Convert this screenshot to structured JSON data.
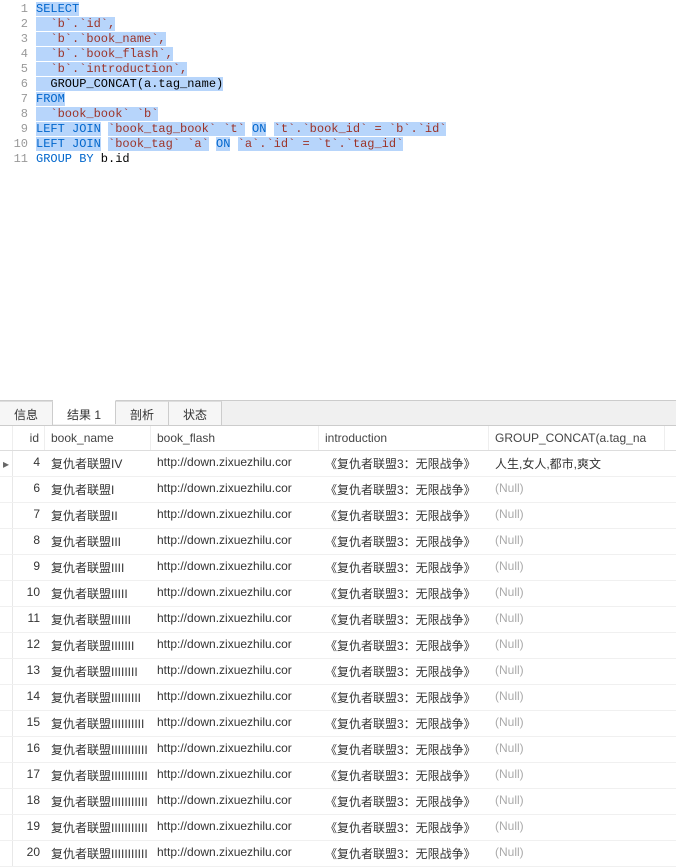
{
  "editor": {
    "lines": [
      {
        "n": 1,
        "tokens": [
          {
            "t": "SELECT",
            "c": "kw",
            "s": true
          }
        ]
      },
      {
        "n": 2,
        "tokens": [
          {
            "t": "  `b`.`id`,",
            "c": "str",
            "s": true
          }
        ]
      },
      {
        "n": 3,
        "tokens": [
          {
            "t": "  `b`.`book_name`,",
            "c": "str",
            "s": true
          }
        ]
      },
      {
        "n": 4,
        "tokens": [
          {
            "t": "  `b`.`book_flash`,",
            "c": "str",
            "s": true
          }
        ]
      },
      {
        "n": 5,
        "tokens": [
          {
            "t": "  `b`.`introduction`,",
            "c": "str",
            "s": true
          }
        ]
      },
      {
        "n": 6,
        "tokens": [
          {
            "t": "  GROUP_CONCAT(a.tag_name)",
            "c": "",
            "s": true
          }
        ]
      },
      {
        "n": 7,
        "tokens": [
          {
            "t": "FROM",
            "c": "kw",
            "s": true
          }
        ]
      },
      {
        "n": 8,
        "tokens": [
          {
            "t": "  `book_book` `b`",
            "c": "str",
            "s": true
          }
        ]
      },
      {
        "n": 9,
        "tokens": [
          {
            "t": "LEFT JOIN",
            "c": "kw",
            "s": true
          },
          {
            "t": " "
          },
          {
            "t": "`book_tag_book` `t`",
            "c": "str",
            "s": true
          },
          {
            "t": " "
          },
          {
            "t": "ON",
            "c": "kw",
            "s": true
          },
          {
            "t": " "
          },
          {
            "t": "`t`.`book_id` = `b`.`id`",
            "c": "str",
            "s": true
          }
        ]
      },
      {
        "n": 10,
        "tokens": [
          {
            "t": "LEFT JOIN",
            "c": "kw",
            "s": true
          },
          {
            "t": " "
          },
          {
            "t": "`book_tag` `a`",
            "c": "str",
            "s": true
          },
          {
            "t": " "
          },
          {
            "t": "ON",
            "c": "kw",
            "s": true
          },
          {
            "t": " "
          },
          {
            "t": "`a`.`id` = `t`.`tag_id`",
            "c": "str",
            "s": true
          }
        ]
      },
      {
        "n": 11,
        "tokens": [
          {
            "t": "GROUP BY",
            "c": "kw"
          },
          {
            "t": " b.id"
          }
        ]
      }
    ]
  },
  "tabs": [
    {
      "label": "信息",
      "active": false
    },
    {
      "label": "结果 1",
      "active": true
    },
    {
      "label": "剖析",
      "active": false
    },
    {
      "label": "状态",
      "active": false
    }
  ],
  "columns": [
    "id",
    "book_name",
    "book_flash",
    "introduction",
    "GROUP_CONCAT(a.tag_na"
  ],
  "rows": [
    {
      "id": 4,
      "book_name": "复仇者联盟IV",
      "book_flash": "http://down.zixuezhilu.cor",
      "introduction": "《复仇者联盟3：无限战争》",
      "concat": "人生,女人,都市,爽文",
      "ptr": true
    },
    {
      "id": 6,
      "book_name": "复仇者联盟I",
      "book_flash": "http://down.zixuezhilu.cor",
      "introduction": "《复仇者联盟3：无限战争》",
      "concat": null
    },
    {
      "id": 7,
      "book_name": "复仇者联盟II",
      "book_flash": "http://down.zixuezhilu.cor",
      "introduction": "《复仇者联盟3：无限战争》",
      "concat": null
    },
    {
      "id": 8,
      "book_name": "复仇者联盟III",
      "book_flash": "http://down.zixuezhilu.cor",
      "introduction": "《复仇者联盟3：无限战争》",
      "concat": null
    },
    {
      "id": 9,
      "book_name": "复仇者联盟IIII",
      "book_flash": "http://down.zixuezhilu.cor",
      "introduction": "《复仇者联盟3：无限战争》",
      "concat": null
    },
    {
      "id": 10,
      "book_name": "复仇者联盟IIIII",
      "book_flash": "http://down.zixuezhilu.cor",
      "introduction": "《复仇者联盟3：无限战争》",
      "concat": null
    },
    {
      "id": 11,
      "book_name": "复仇者联盟IIIIII",
      "book_flash": "http://down.zixuezhilu.cor",
      "introduction": "《复仇者联盟3：无限战争》",
      "concat": null
    },
    {
      "id": 12,
      "book_name": "复仇者联盟IIIIIII",
      "book_flash": "http://down.zixuezhilu.cor",
      "introduction": "《复仇者联盟3：无限战争》",
      "concat": null
    },
    {
      "id": 13,
      "book_name": "复仇者联盟IIIIIIII",
      "book_flash": "http://down.zixuezhilu.cor",
      "introduction": "《复仇者联盟3：无限战争》",
      "concat": null
    },
    {
      "id": 14,
      "book_name": "复仇者联盟IIIIIIIII",
      "book_flash": "http://down.zixuezhilu.cor",
      "introduction": "《复仇者联盟3：无限战争》",
      "concat": null
    },
    {
      "id": 15,
      "book_name": "复仇者联盟IIIIIIIIII",
      "book_flash": "http://down.zixuezhilu.cor",
      "introduction": "《复仇者联盟3：无限战争》",
      "concat": null
    },
    {
      "id": 16,
      "book_name": "复仇者联盟IIIIIIIIIII",
      "book_flash": "http://down.zixuezhilu.cor",
      "introduction": "《复仇者联盟3：无限战争》",
      "concat": null
    },
    {
      "id": 17,
      "book_name": "复仇者联盟IIIIIIIIIII",
      "book_flash": "http://down.zixuezhilu.cor",
      "introduction": "《复仇者联盟3：无限战争》",
      "concat": null
    },
    {
      "id": 18,
      "book_name": "复仇者联盟IIIIIIIIIII",
      "book_flash": "http://down.zixuezhilu.cor",
      "introduction": "《复仇者联盟3：无限战争》",
      "concat": null
    },
    {
      "id": 19,
      "book_name": "复仇者联盟IIIIIIIIIII",
      "book_flash": "http://down.zixuezhilu.cor",
      "introduction": "《复仇者联盟3：无限战争》",
      "concat": null
    },
    {
      "id": 20,
      "book_name": "复仇者联盟IIIIIIIIIII",
      "book_flash": "http://down.zixuezhilu.cor",
      "introduction": "《复仇者联盟3：无限战争》",
      "concat": null
    }
  ],
  "null_text": "(Null)"
}
